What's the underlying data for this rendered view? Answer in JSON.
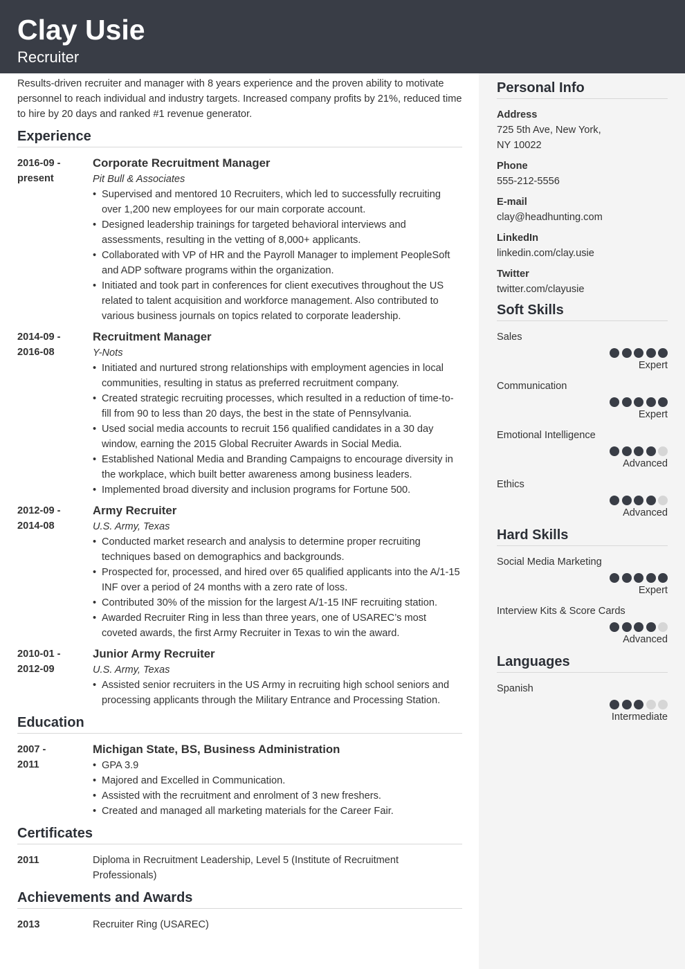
{
  "header": {
    "name": "Clay Usie",
    "role": "Recruiter"
  },
  "summary": "Results-driven recruiter and manager with 8 years experience and the proven ability to motivate personnel to reach individual and industry targets. Increased company profits by 21%, reduced time to hire by 20 days and ranked #1 revenue generator.",
  "experience": {
    "title": "Experience",
    "items": [
      {
        "date_start": "2016-09 -",
        "date_end": "present",
        "title": "Corporate Recruitment Manager",
        "company": "Pit Bull & Associates",
        "bullets": [
          "Supervised and mentored 10 Recruiters, which led to successfully recruiting over 1,200 new employees for our main corporate account.",
          "Designed leadership trainings for targeted behavioral interviews and assessments, resulting in the vetting of 8,000+ applicants.",
          "Collaborated with VP of HR and the Payroll Manager to implement PeopleSoft and ADP software programs within the organization.",
          "Initiated and took part in conferences for client executives throughout the US related to talent acquisition and workforce management. Also contributed to various business journals on topics related to corporate leadership."
        ]
      },
      {
        "date_start": "2014-09 -",
        "date_end": "2016-08",
        "title": "Recruitment Manager",
        "company": "Y-Nots",
        "bullets": [
          "Initiated and nurtured strong relationships with employment agencies in local communities, resulting in status as preferred recruitment company.",
          "Created strategic recruiting processes, which resulted in a reduction of time-to-fill from 90 to less than 20 days, the best in the state of Pennsylvania.",
          "Used social media accounts to recruit 156 qualified candidates in a 30 day window, earning the 2015 Global Recruiter Awards in Social Media.",
          "Established National Media and Branding Campaigns to encourage diversity in the workplace, which built better awareness among business leaders.",
          "Implemented broad diversity and inclusion programs for Fortune 500."
        ]
      },
      {
        "date_start": "2012-09 -",
        "date_end": "2014-08",
        "title": "Army Recruiter",
        "company": "U.S. Army, Texas",
        "bullets": [
          "Conducted market research and analysis to determine proper recruiting techniques based on demographics and backgrounds.",
          "Prospected for, processed, and hired over 65 qualified applicants into the A/1-15 INF over a period of 24 months with a zero rate of loss.",
          "Contributed 30% of the mission for the largest A/1-15 INF recruiting station.",
          "Awarded Recruiter Ring in less than three years, one of USAREC’s most coveted awards, the first Army Recruiter in Texas to win the award."
        ]
      },
      {
        "date_start": "2010-01 -",
        "date_end": "2012-09",
        "title": "Junior Army Recruiter",
        "company": "U.S. Army, Texas",
        "bullets": [
          "Assisted senior recruiters in the US Army in recruiting high school seniors and processing applicants through the Military Entrance and Processing Station."
        ]
      }
    ]
  },
  "education": {
    "title": "Education",
    "items": [
      {
        "date_start": "2007 -",
        "date_end": "2011",
        "title": "Michigan State, BS, Business Administration",
        "bullets": [
          "GPA 3.9",
          "Majored and Excelled in Communication.",
          "Assisted with the recruitment and enrolment of 3 new freshers.",
          "Created and managed all marketing materials for the Career Fair."
        ]
      }
    ]
  },
  "certificates": {
    "title": "Certificates",
    "items": [
      {
        "date": "2011",
        "text": "Diploma in Recruitment Leadership, Level 5  (Institute of Recruitment Professionals)"
      }
    ]
  },
  "awards": {
    "title": "Achievements and Awards",
    "items": [
      {
        "date": "2013",
        "text": "Recruiter Ring (USAREC)"
      }
    ]
  },
  "personal_info": {
    "title": "Personal Info",
    "address_label": "Address",
    "address_line1": "725 5th Ave, New York,",
    "address_line2": "NY 10022",
    "phone_label": "Phone",
    "phone": "555-212-5556",
    "email_label": "E-mail",
    "email": "clay@headhunting.com",
    "linkedin_label": "LinkedIn",
    "linkedin": "linkedin.com/clay.usie",
    "twitter_label": "Twitter",
    "twitter": "twitter.com/clayusie"
  },
  "soft_skills": {
    "title": "Soft Skills",
    "items": [
      {
        "name": "Sales",
        "rating": 5,
        "max": 5,
        "level": "Expert"
      },
      {
        "name": "Communication",
        "rating": 5,
        "max": 5,
        "level": "Expert"
      },
      {
        "name": "Emotional Intelligence",
        "rating": 4,
        "max": 5,
        "level": "Advanced"
      },
      {
        "name": "Ethics",
        "rating": 4,
        "max": 5,
        "level": "Advanced"
      }
    ]
  },
  "hard_skills": {
    "title": "Hard Skills",
    "items": [
      {
        "name": "Social Media Marketing",
        "rating": 5,
        "max": 5,
        "level": "Expert"
      },
      {
        "name": "Interview Kits & Score Cards",
        "rating": 4,
        "max": 5,
        "level": "Advanced"
      }
    ]
  },
  "languages": {
    "title": "Languages",
    "items": [
      {
        "name": "Spanish",
        "rating": 3,
        "max": 5,
        "level": "Intermediate"
      }
    ]
  }
}
